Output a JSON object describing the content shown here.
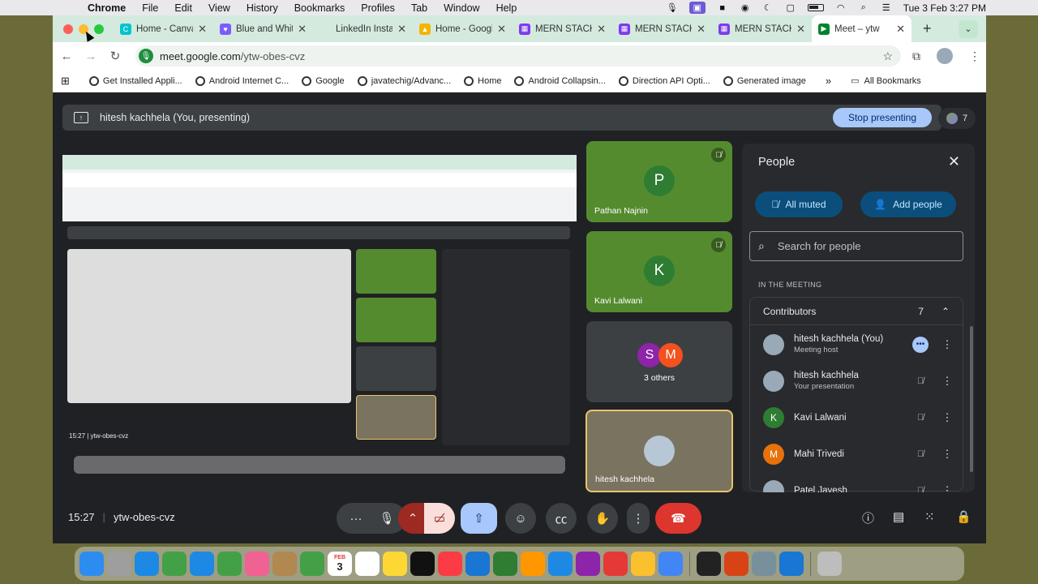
{
  "menubar": {
    "app": "Chrome",
    "items": [
      "File",
      "Edit",
      "View",
      "History",
      "Bookmarks",
      "Profiles",
      "Tab",
      "Window",
      "Help"
    ],
    "datetime": "Tue 3 Feb  3:27 PM"
  },
  "tabs": [
    {
      "title": "Home - Canva",
      "color": "#00c4cc",
      "glyph": "C"
    },
    {
      "title": "Blue and White",
      "color": "#7b5cff",
      "glyph": "♥"
    },
    {
      "title": "LinkedIn Insta",
      "color": "#d4eadf",
      "glyph": ""
    },
    {
      "title": "Home - Google",
      "color": "#f4b400",
      "glyph": "▲"
    },
    {
      "title": "MERN STACK",
      "color": "#7c3aed",
      "glyph": "▦"
    },
    {
      "title": "MERN STACK",
      "color": "#7c3aed",
      "glyph": "▦"
    },
    {
      "title": "MERN STACK",
      "color": "#7c3aed",
      "glyph": "▦"
    },
    {
      "title": "Meet – ytw",
      "color": "#00832d",
      "glyph": "▶",
      "active": true
    }
  ],
  "address": {
    "domain": "meet.google.com",
    "path": "/ytw-obes-cvz"
  },
  "bookmarks": {
    "items": [
      "Get Installed Appli...",
      "Android Internet C...",
      "Google",
      "javatechig/Advanc...",
      "Home",
      "Android Collapsin...",
      "Direction API Opti...",
      "Generated image"
    ],
    "all": "All Bookmarks"
  },
  "meet": {
    "presenting_label": "hitesh kachhela (You, presenting)",
    "stop_presenting": "Stop presenting",
    "participant_count": "7",
    "tiles": [
      {
        "initial": "P",
        "name": "Pathan Najnin",
        "color": "#388e3c"
      },
      {
        "initial": "K",
        "name": "Kavi Lalwani",
        "color": "#388e3c"
      }
    ],
    "others": {
      "initials": [
        "S",
        "M"
      ],
      "colors": [
        "#8e24aa",
        "#f4511e"
      ],
      "label": "3 others"
    },
    "self_tile_name": "hitesh kachhela",
    "time": "15:27",
    "meeting_code": "ytw-obes-cvz"
  },
  "people_panel": {
    "title": "People",
    "all_muted": "All muted",
    "add_people": "Add people",
    "search_placeholder": "Search for people",
    "section": "IN THE MEETING",
    "group": "Contributors",
    "group_count": "7",
    "people": [
      {
        "name": "hitesh kachhela (You)",
        "sub": "Meeting host",
        "initial": "",
        "color": "#9aa9b8"
      },
      {
        "name": "hitesh kachhela",
        "sub": "Your presentation",
        "initial": "",
        "color": "#9aa9b8"
      },
      {
        "name": "Kavi Lalwani",
        "sub": "",
        "initial": "K",
        "color": "#2e7d32"
      },
      {
        "name": "Mahi Trivedi",
        "sub": "",
        "initial": "M",
        "color": "#e8710a"
      },
      {
        "name": "Patel Jayesh",
        "sub": "",
        "initial": "",
        "color": "#9aa9b8"
      }
    ]
  },
  "dock_apps": [
    "Finder",
    "Launchpad",
    "Safari",
    "Messages",
    "Mail",
    "Maps",
    "Photos",
    "Contacts",
    "FaceTime",
    "Calendar",
    "Reminders",
    "Notes",
    "TV",
    "Music",
    "Keynote",
    "Numbers",
    "Pages",
    "App Store",
    "Podcasts",
    "Toolbox",
    "Slides",
    "Chrome",
    "PyCharm",
    "PowerPoint",
    "Preview",
    "VS Code",
    "Trash"
  ],
  "calendar_icon": {
    "month": "FEB",
    "day": "3"
  }
}
